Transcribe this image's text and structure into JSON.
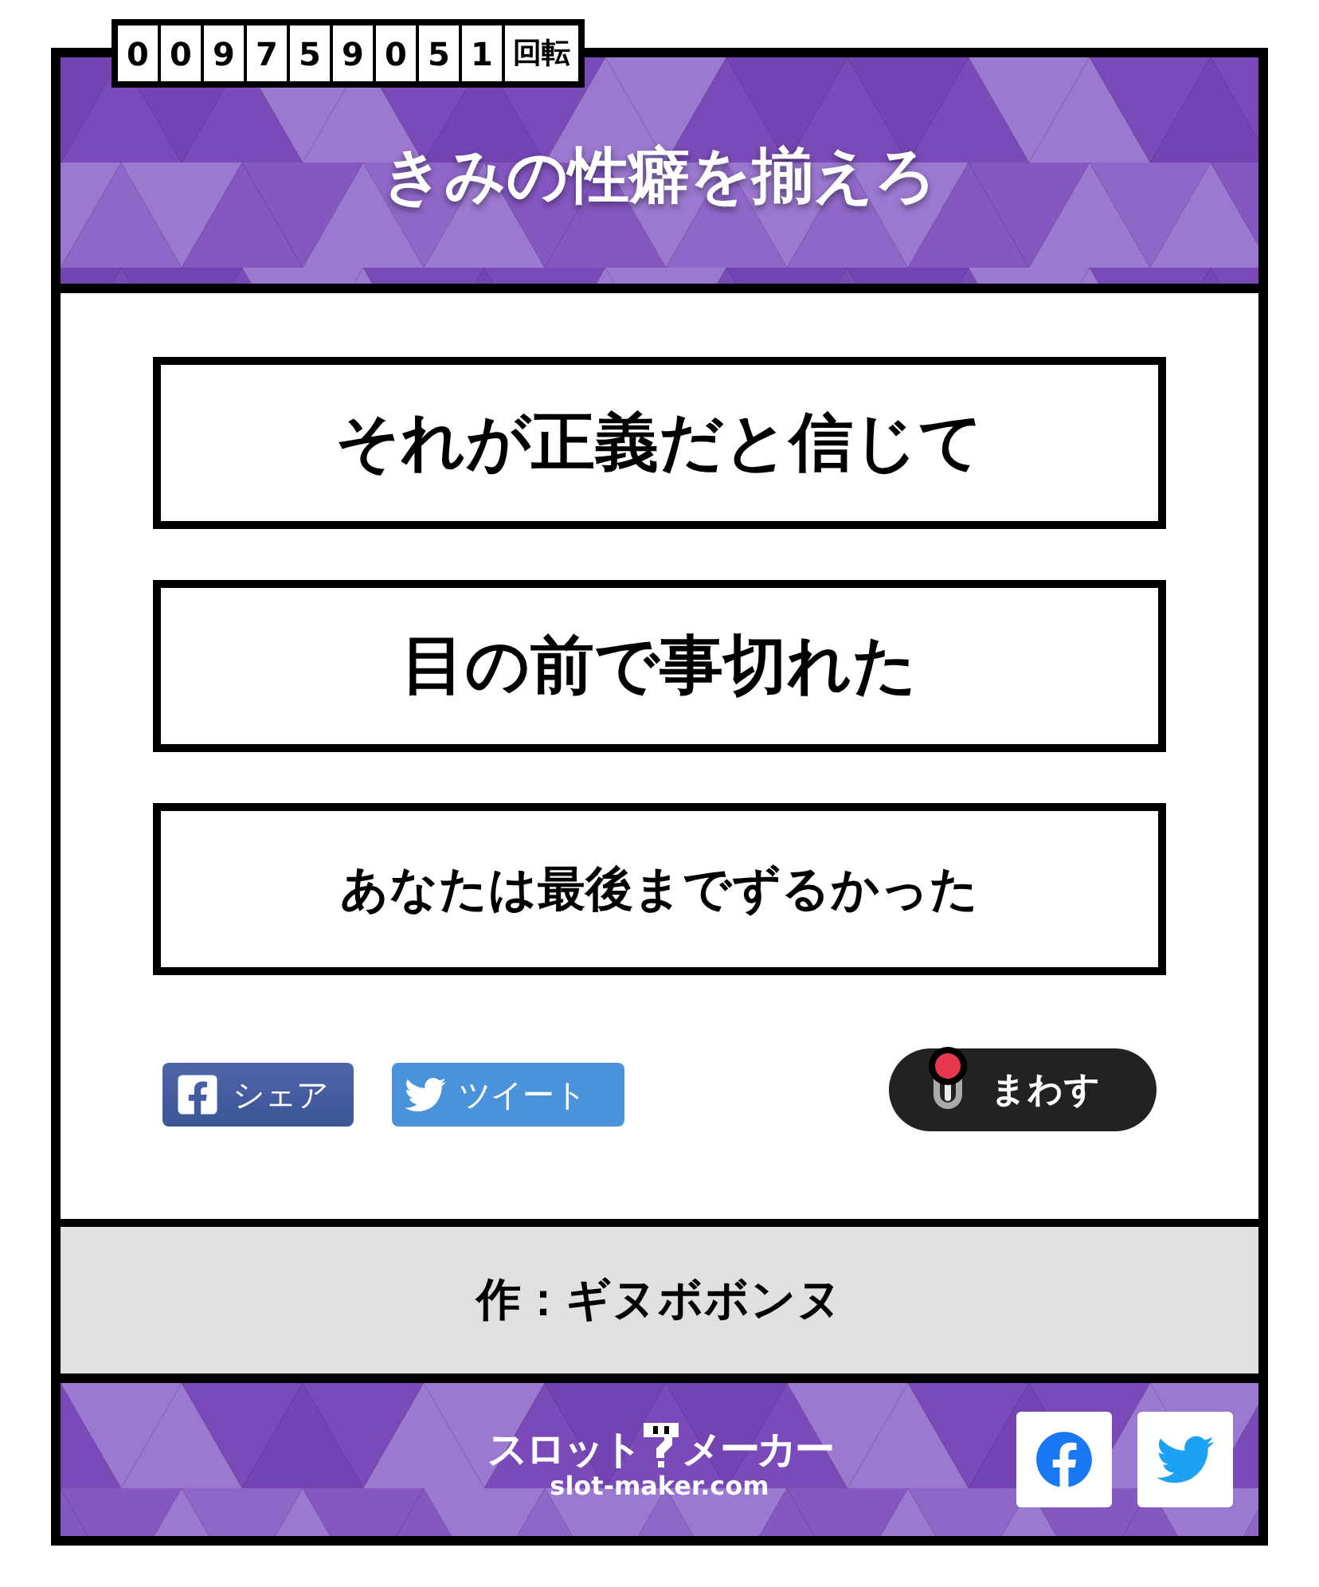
{
  "counter": {
    "digits": [
      "0",
      "0",
      "9",
      "7",
      "5",
      "9",
      "0",
      "5",
      "1"
    ],
    "unit": "回転"
  },
  "title": "きみの性癖を揃えろ",
  "reels": [
    {
      "text": "それが正義だと信じて"
    },
    {
      "text": "目の前で事切れた"
    },
    {
      "text": "あなたは最後までずるかった"
    }
  ],
  "share_buttons": [
    {
      "kind": "facebook",
      "label": "シェア"
    },
    {
      "kind": "twitter",
      "label": "ツイート"
    }
  ],
  "spin_button": {
    "label": "まわす"
  },
  "author": "作：ギヌボボンヌ",
  "footer": {
    "logo_left": "スロット",
    "logo_right": "メーカー",
    "logo_url": "slot-maker.com",
    "social_links": [
      {
        "kind": "facebook"
      },
      {
        "kind": "twitter"
      }
    ]
  }
}
